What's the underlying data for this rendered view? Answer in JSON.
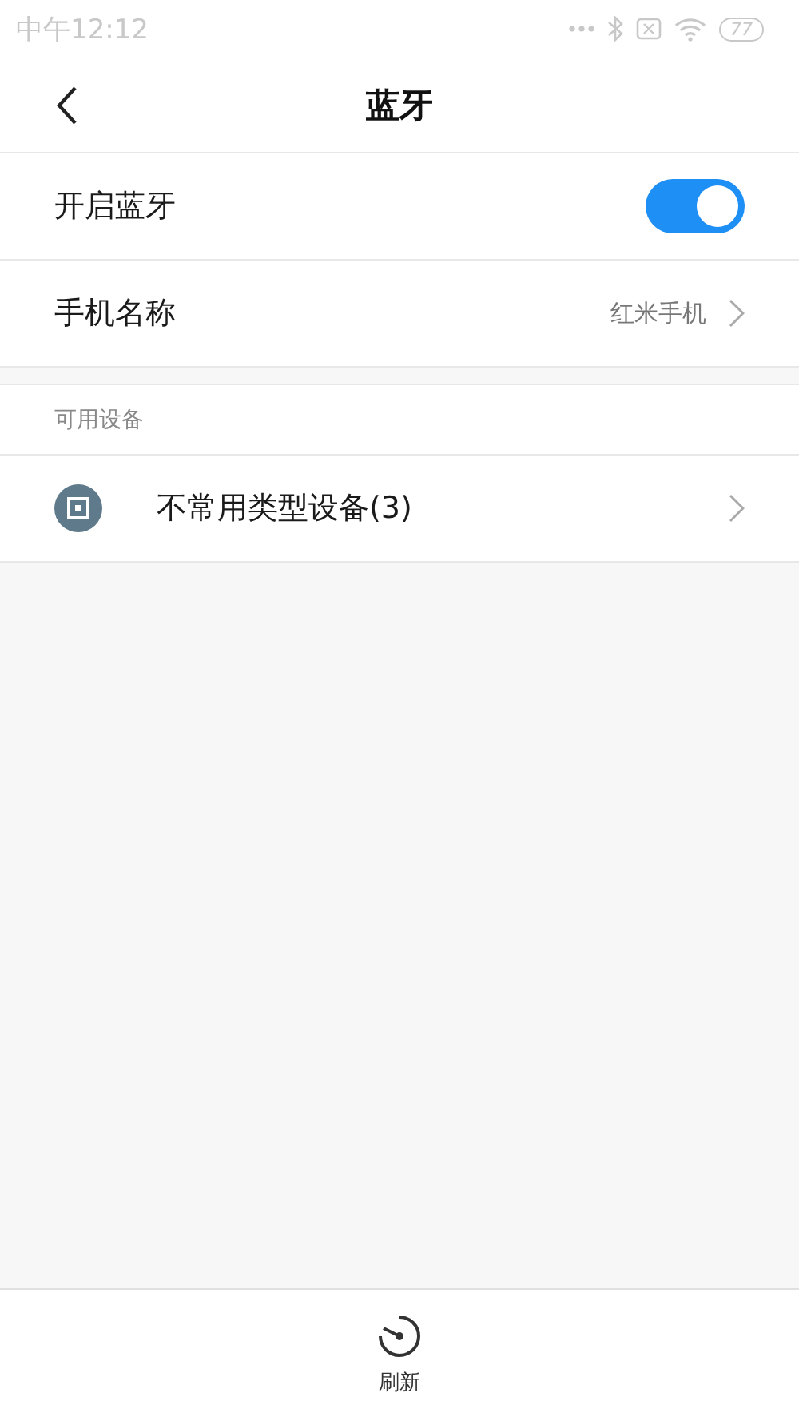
{
  "status_bar": {
    "time": "中午12:12",
    "battery": "77"
  },
  "header": {
    "title": "蓝牙"
  },
  "settings": [
    {
      "kind": "toggle",
      "label": "开启蓝牙",
      "on": true
    },
    {
      "kind": "link",
      "label": "手机名称",
      "value": "红米手机"
    }
  ],
  "section": {
    "title": "可用设备",
    "devices": [
      {
        "name": "不常用类型设备(3)"
      }
    ]
  },
  "bottom_bar": {
    "actions": [
      {
        "label": "刷新"
      }
    ]
  }
}
